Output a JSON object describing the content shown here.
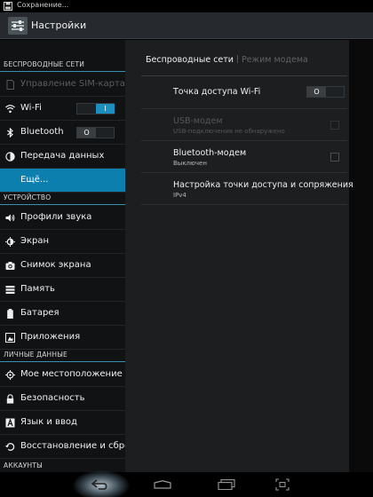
{
  "status_bar": {
    "text": "Сохранение...",
    "icon": "save-icon"
  },
  "action_bar": {
    "title": "Настройки",
    "icon": "settings-app-icon"
  },
  "sidebar": {
    "sections": [
      {
        "label": "БЕСПРОВОДНЫЕ СЕТИ"
      },
      {
        "label": "УСТРОЙСТВО"
      },
      {
        "label": "ЛИЧНЫЕ ДАННЫЕ"
      },
      {
        "label": "АККАУНТЫ"
      }
    ],
    "items": [
      {
        "label": "Управление SIM-картами",
        "icon": "sim-icon",
        "disabled": true
      },
      {
        "label": "Wi-Fi",
        "icon": "wifi-icon",
        "toggle": "I"
      },
      {
        "label": "Bluetooth",
        "icon": "bluetooth-icon",
        "toggle": "O"
      },
      {
        "label": "Передача данных",
        "icon": "data-usage-icon"
      },
      {
        "label": "Ещё...",
        "active": true
      },
      {
        "label": "Профили звука",
        "icon": "volume-icon"
      },
      {
        "label": "Экран",
        "icon": "display-icon"
      },
      {
        "label": "Снимок экрана",
        "icon": "camera-icon"
      },
      {
        "label": "Память",
        "icon": "storage-icon"
      },
      {
        "label": "Батарея",
        "icon": "battery-icon"
      },
      {
        "label": "Приложения",
        "icon": "apps-icon"
      },
      {
        "label": "Мое местоположение",
        "icon": "location-icon"
      },
      {
        "label": "Безопасность",
        "icon": "lock-icon"
      },
      {
        "label": "Язык и ввод",
        "icon": "language-icon"
      },
      {
        "label": "Восстановление и сброс",
        "icon": "restore-icon"
      }
    ]
  },
  "content": {
    "tabs": {
      "active": "Беспроводные сети",
      "inactive": "Режим модема"
    },
    "rows": [
      {
        "title": "Точка доступа Wi-Fi",
        "subtitle": "",
        "toggle": "O"
      },
      {
        "title": "USB-модем",
        "subtitle": "USB-подключения не обнаружено",
        "disabled": true
      },
      {
        "title": "Bluetooth-модем",
        "subtitle": "Выключен"
      },
      {
        "title": "Настройка точки доступа и сопряжения",
        "subtitle": "IPv4"
      }
    ]
  },
  "navbar": {
    "buttons": [
      "back",
      "home",
      "recent-apps",
      "screenshot"
    ]
  },
  "colors": {
    "accent": "#0d7fae",
    "toggle_on": "#1a8fc0",
    "sidebar_bg": "#101213",
    "panel_bg": "#1c1e20"
  }
}
